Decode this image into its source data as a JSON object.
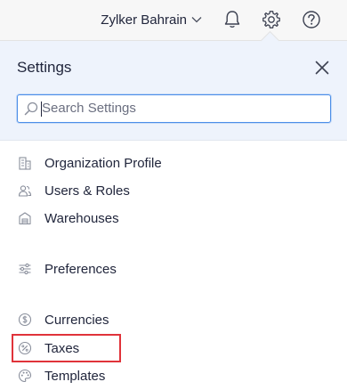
{
  "topbar": {
    "org_name": "Zylker Bahrain",
    "icons": [
      "chevron-down-icon",
      "bell-icon",
      "gear-icon",
      "help-icon"
    ]
  },
  "settings_panel": {
    "title": "Settings",
    "close_icon": "close-icon",
    "search": {
      "placeholder": "Search Settings",
      "value": ""
    }
  },
  "menu": {
    "items": [
      {
        "label": "Organization Profile",
        "icon": "building-icon"
      },
      {
        "label": "Users & Roles",
        "icon": "users-icon"
      },
      {
        "label": "Warehouses",
        "icon": "warehouse-icon"
      },
      {
        "label": "Preferences",
        "icon": "sliders-icon"
      },
      {
        "label": "Currencies",
        "icon": "dollar-coin-icon"
      },
      {
        "label": "Taxes",
        "icon": "percent-icon"
      },
      {
        "label": "Templates",
        "icon": "palette-icon"
      }
    ]
  },
  "colors": {
    "topbar_bg": "#f7f7f7",
    "panel_head_bg": "#eef3fc",
    "accent_blue": "#4c8ee8",
    "highlight_red": "#e0333a",
    "text": "#21263c",
    "icon_gray": "#8a8f9c"
  }
}
